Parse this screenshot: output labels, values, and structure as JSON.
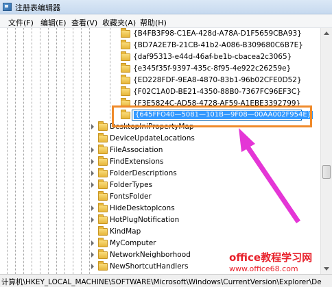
{
  "window": {
    "title": "注册表编辑器"
  },
  "menu": [
    "文件(F)",
    "编辑(E)",
    "查看(V)",
    "收藏夹(A)",
    "帮助(H)"
  ],
  "guid_keys": [
    "{B4FB3F98-C1EA-428d-A78A-D1F5659CBA93}",
    "{BD7A2E7B-21CB-41b2-A086-B309680C6B7E}",
    "{daf95313-e44d-46af-be1b-cbacea2c3065}",
    "{e345f35f-9397-435c-8f95-4e922c26259e}",
    "{ED228FDF-9EA8-4870-83b1-96b02CFE0D52}",
    "{F02C1A0D-BE21-4350-88B0-7367FC96EF3C}",
    "{F3E5824C-AD58-4728-AF59-A1EBE3392799}"
  ],
  "editing_key": "{645FFO40—5081—101B—9F08—00AA002F954E}",
  "subkeys": [
    "DesktopIniPropertyMap",
    "DeviceUpdateLocations",
    "FileAssociation",
    "FindExtensions",
    "FolderDescriptions",
    "FolderTypes",
    "FontsFolder",
    "HideDesktopIcons",
    "HotPlugNotification",
    "KindMap",
    "MyComputer",
    "NetworkNeighborhood",
    "NewShortcutHandlers"
  ],
  "status": {
    "path": "计算机\\HKEY_LOCAL_MACHINE\\SOFTWARE\\Microsoft\\Windows\\CurrentVersion\\Explorer\\De"
  },
  "watermark": {
    "main": "office教程学习网",
    "url": "www.office68.com"
  },
  "colors": {
    "highlight_border": "#ef8a2a",
    "arrow": "#e436d6",
    "selection": "#3399ff",
    "watermark": "#e8202a"
  },
  "icons": {
    "folder": "folder-icon",
    "expander": "expand-arrow-icon",
    "app": "regedit-icon"
  }
}
